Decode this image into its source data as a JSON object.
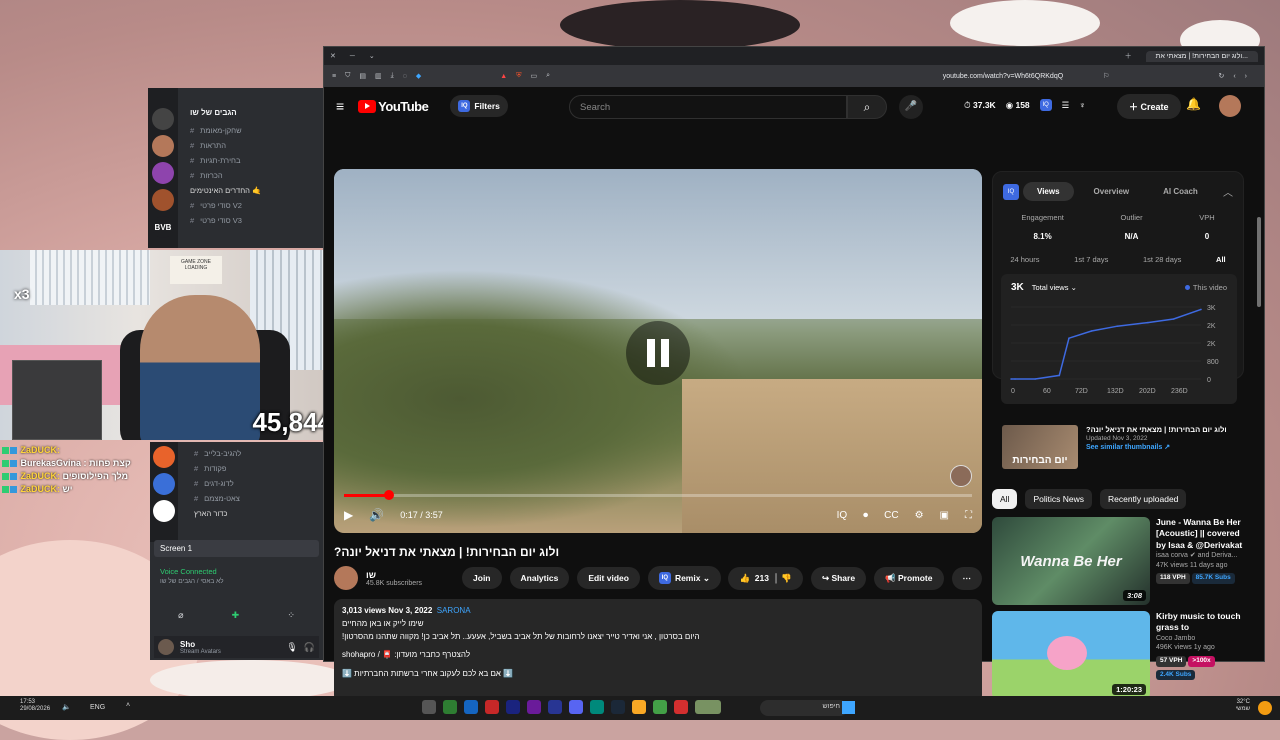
{
  "discord_top": {
    "server_title": "הגבים של שו",
    "server_icons": [
      "",
      "",
      "",
      "",
      "BVB",
      ""
    ],
    "channels": [
      {
        "label": "שחקן-מאומת"
      },
      {
        "label": "התראות"
      },
      {
        "label": "בחירת-תגיות"
      },
      {
        "label": "הכרזות"
      },
      {
        "label": "החדרים האינטימים 🤙"
      },
      {
        "label": "סודי פרטי V2"
      },
      {
        "label": "סודי פרטי V3"
      }
    ]
  },
  "webcam": {
    "viewer_count": "45,844",
    "multiplier": "x3",
    "sign_text": "GAME ZONE\nLOADING"
  },
  "chat": {
    "lines": [
      {
        "name": "ZaDUCK:",
        "msg": ""
      },
      {
        "name": "BurekasGvina :",
        "msg": "קצת פחות"
      },
      {
        "name": "ZaDUCK:",
        "msg": "מלך הפילוסופים"
      },
      {
        "name": "ZaDUCK:",
        "msg": "יש"
      }
    ]
  },
  "discord_bottom": {
    "channels": [
      {
        "label": "להגיב-בלייב"
      },
      {
        "label": "פקודות"
      },
      {
        "label": "לדוג-דגים"
      },
      {
        "label": "צאט-מצמם"
      },
      {
        "label": "כדור הארץ"
      }
    ],
    "screen_label": "Screen 1",
    "voice_status": "Voice Connected",
    "voice_channel": "לא באסי / הגבים של שו",
    "user_name": "Sho",
    "user_status": "Stream Avatars"
  },
  "browser": {
    "tab_title": "ולוג יום הבחירות! | מצאתי את...",
    "url": "youtube.com/watch?v=Wh6t6QRKdqQ"
  },
  "youtube": {
    "logo_text": "YouTube",
    "filters_label": "Filters",
    "search_placeholder": "Search",
    "header_views": "37.3K",
    "header_watching": "158",
    "create_label": "Create",
    "player": {
      "time_current": "0:17",
      "time_total": "3:57",
      "time_display": "0:17 / 3:57",
      "progress_fraction": 0.072,
      "buffer_fraction": 0.19
    },
    "video_title": "ולוג יום הבחירות! | מצאתי את דניאל יונה?",
    "channel_name": "שו",
    "subscribers": "45.8K subscribers",
    "join_label": "Join",
    "analytics_label": "Analytics",
    "edit_label": "Edit video",
    "remix_label": "Remix",
    "likes": "213",
    "share_label": "Share",
    "promote_label": "Promote",
    "description": {
      "meta": "3,013 views  Nov 3, 2022",
      "tag": "SARONA",
      "line1": "היום בסרטון , אני ואדיר טייר יצאנו לרחובות של תל אביב בשביל, אעעע.. תל אביב כן! מקווה שתהנו מהסרטון!",
      "line2": "שימו לייק או באן מהחיים",
      "line3": "להצטרף כחברי מועדון: 📮 / shohapro",
      "line4": "⬇️ אם בא לכם לעקוב אחרי ברשתות החברתיות ⬇️"
    }
  },
  "vidiq": {
    "tabs": [
      "Views",
      "Overview",
      "AI Coach"
    ],
    "metrics": [
      {
        "label": "Engagement",
        "value": "8.1%"
      },
      {
        "label": "Outlier",
        "value": "N/A"
      },
      {
        "label": "VPH",
        "value": "0"
      }
    ],
    "ranges": [
      "24 hours",
      "1st 7 days",
      "1st 28 days",
      "All"
    ],
    "total_views": "3K",
    "total_views_label": "Total views",
    "legend_label": "This video",
    "y_ticks": [
      "3K",
      "2K",
      "2K",
      "800",
      "0"
    ],
    "x_ticks": [
      "0",
      "60",
      "72D",
      "132D",
      "202D",
      "236D"
    ],
    "thumb_title": "ולוג יום הבחירות! | מצאתי את דניאל יונה?",
    "thumb_updated": "Updated Nov 3, 2022",
    "thumb_link": "See similar thumbnails ↗",
    "thumb_text": "יום הבחירות"
  },
  "chart_data": {
    "type": "line",
    "x": [
      0,
      5,
      30,
      60,
      72,
      100,
      132,
      170,
      202,
      236
    ],
    "values": [
      0,
      0,
      0,
      150,
      1700,
      2000,
      2200,
      2350,
      2500,
      2900
    ],
    "x_tick_labels": [
      "0",
      "60",
      "72D",
      "132D",
      "202D",
      "236D"
    ],
    "y_tick_labels": [
      "3K",
      "2K",
      "2K",
      "800",
      "0"
    ],
    "ylim": [
      0,
      3000
    ],
    "legend": [
      "This video"
    ],
    "color": "#3e6ae1"
  },
  "chips": [
    "All",
    "Politics News",
    "Recently uploaded"
  ],
  "recommendations": [
    {
      "title": "June - Wanna Be Her [Acoustic] || covered by Isaa & @Derivakat",
      "channel": "isaa corva ✔ and Deriva...",
      "stats": "47K views  11 days ago",
      "badge1": "118 VPH",
      "badge2": "85.7K Subs",
      "duration": "3:08",
      "thumb_text": "Wanna Be Her"
    },
    {
      "title": "Kirby music to touch grass to",
      "channel": "Coco Jambo",
      "stats": "496K views  1y ago",
      "badge1": "57 VPH",
      "badge2": ">100x",
      "badge3": "2.4K Subs",
      "duration": "1:20:23",
      "thumb_text": ""
    }
  ],
  "taskbar": {
    "time": "17:53",
    "date": "29/08/2026",
    "lang": "ENG",
    "search_placeholder": "חיפוש",
    "weather": "32°C",
    "weather_desc": "שמשי"
  },
  "colors": {
    "yt_red": "#ff0000",
    "accent_blue": "#3ea6ff",
    "vidiq_blue": "#3e6ae1"
  }
}
